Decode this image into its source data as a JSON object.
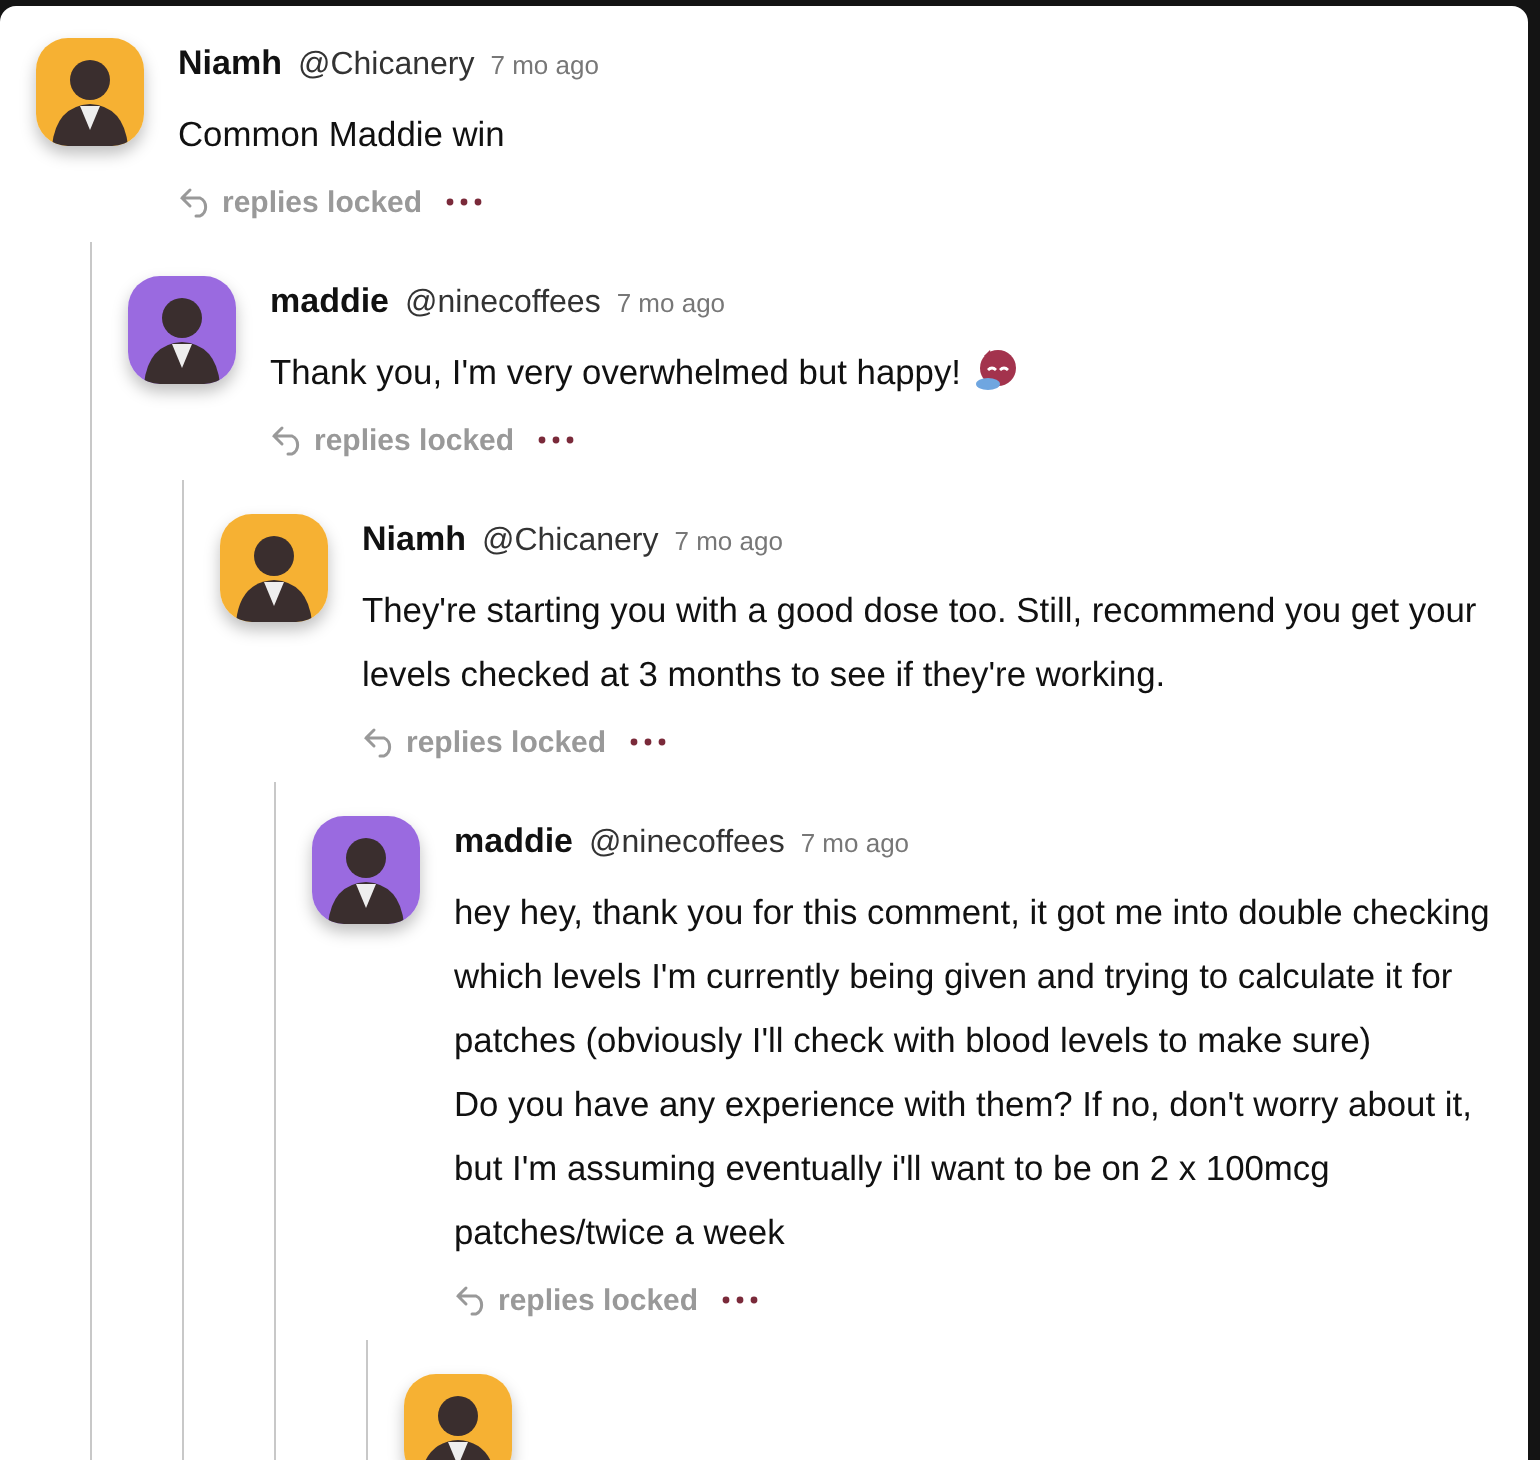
{
  "comments": [
    {
      "name": "Niamh",
      "handle": "@Chicanery",
      "time": "7 mo ago",
      "color": "#f6b133",
      "paragraphs": [
        "Common Maddie win"
      ],
      "action": "replies locked",
      "children": [
        {
          "name": "maddie",
          "handle": "@ninecoffees",
          "time": "7 mo ago",
          "color": "#9a6ae0",
          "paragraphs": [
            "Thank you, I'm very overwhelmed but happy!"
          ],
          "emoji": true,
          "action": "replies locked",
          "children": [
            {
              "name": "Niamh",
              "handle": "@Chicanery",
              "time": "7 mo ago",
              "color": "#f6b133",
              "paragraphs": [
                "They're starting you with a good dose too. Still, recommend you get your levels checked at 3 months to see if they're working."
              ],
              "action": "replies locked",
              "children": [
                {
                  "name": "maddie",
                  "handle": "@ninecoffees",
                  "time": "7 mo ago",
                  "color": "#9a6ae0",
                  "paragraphs": [
                    "hey hey, thank you for this comment, it got me into double checking which levels I'm currently being given and trying to calculate it for patches (obviously I'll check with blood levels to make sure)",
                    "Do you have any experience with them? If no, don't worry about it, but I'm assuming eventually i'll want to be on 2 x 100mcg patches/twice a week"
                  ],
                  "action": "replies locked",
                  "children": [
                    {
                      "color": "#f6b133"
                    }
                  ]
                }
              ]
            }
          ]
        }
      ]
    }
  ]
}
